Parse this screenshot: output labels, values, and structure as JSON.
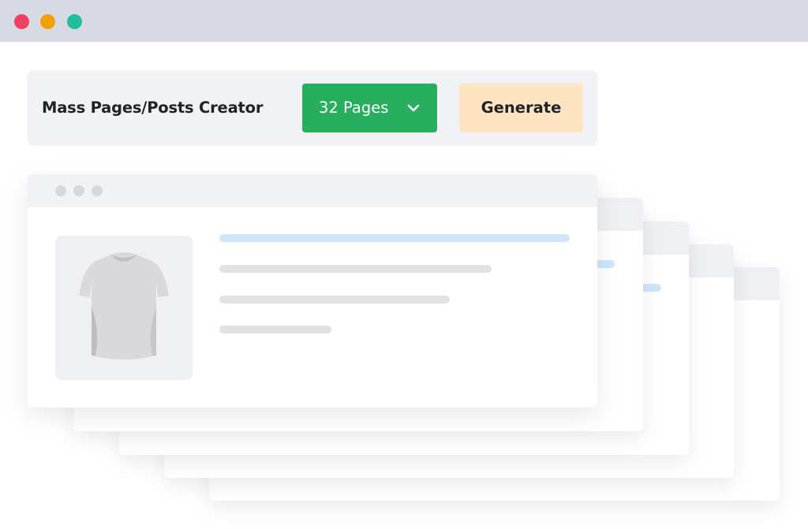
{
  "window": {
    "controls": [
      "close-dot",
      "minimize-dot",
      "maximize-dot"
    ],
    "colors": {
      "close": "#ec4460",
      "minimize": "#f59e0b",
      "maximize": "#1fbf9d"
    }
  },
  "toolbar": {
    "title": "Mass Pages/Posts Creator",
    "pages_select": {
      "value": "32 Pages",
      "icon": "chevron-down-icon",
      "color": "#27ae5f"
    },
    "generate_label": "Generate",
    "generate_color": "#fde5c3"
  },
  "preview": {
    "page_count_shown": 5,
    "product_image": "t-shirt-icon"
  }
}
